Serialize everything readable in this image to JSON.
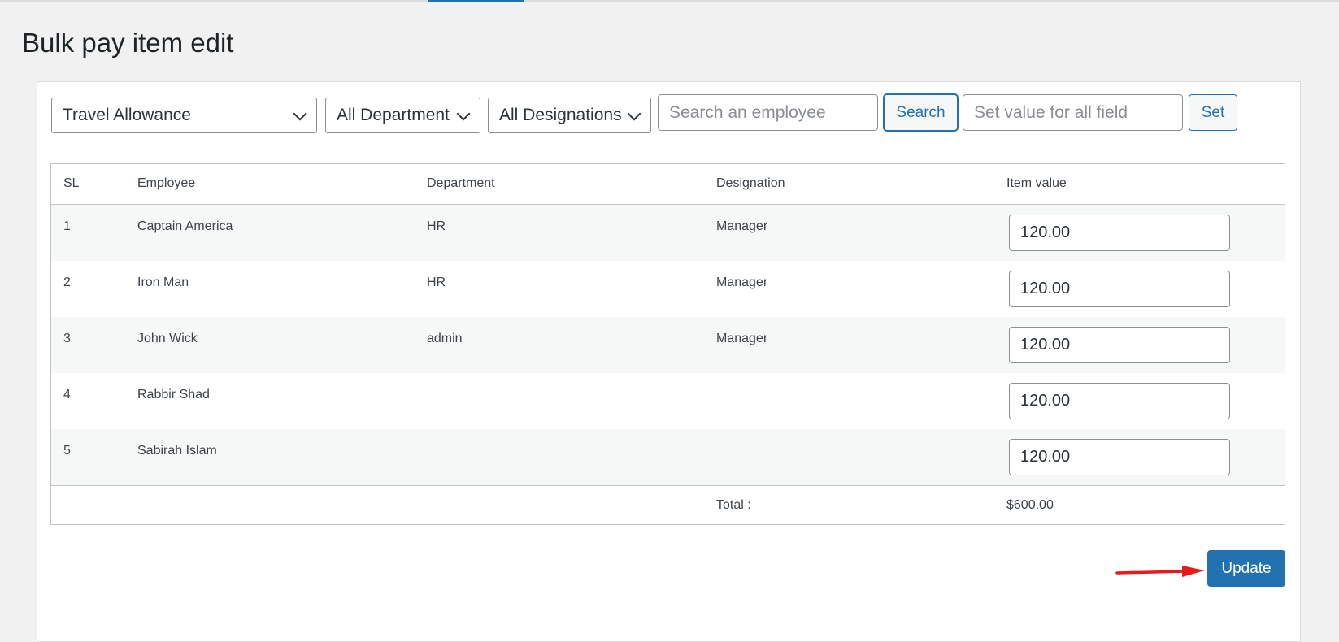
{
  "page": {
    "title": "Bulk pay item edit"
  },
  "filters": {
    "pay_item": "Travel Allowance",
    "department": "All Department",
    "designation": "All Designations",
    "search_placeholder": "Search an employee",
    "search_label": "Search",
    "set_placeholder": "Set value for all field",
    "set_label": "Set"
  },
  "table": {
    "headers": {
      "sl": "SL",
      "employee": "Employee",
      "department": "Department",
      "designation": "Designation",
      "item_value": "Item value"
    },
    "rows": [
      {
        "sl": "1",
        "employee": "Captain America",
        "department": "HR",
        "designation": "Manager",
        "value": "120.00"
      },
      {
        "sl": "2",
        "employee": "Iron Man",
        "department": "HR",
        "designation": "Manager",
        "value": "120.00"
      },
      {
        "sl": "3",
        "employee": "John Wick",
        "department": "admin",
        "designation": "Manager",
        "value": "120.00"
      },
      {
        "sl": "4",
        "employee": "Rabbir Shad",
        "department": "",
        "designation": "",
        "value": "120.00"
      },
      {
        "sl": "5",
        "employee": "Sabirah Islam",
        "department": "",
        "designation": "",
        "value": "120.00"
      }
    ],
    "total_label": "Total :",
    "total_value": "$600.00"
  },
  "actions": {
    "update_label": "Update"
  },
  "colors": {
    "accent": "#2271b1",
    "annotation_arrow": "#e8191a"
  },
  "icons": {
    "dropdown": "chevron-down-icon",
    "annotation": "red-arrow-icon"
  }
}
